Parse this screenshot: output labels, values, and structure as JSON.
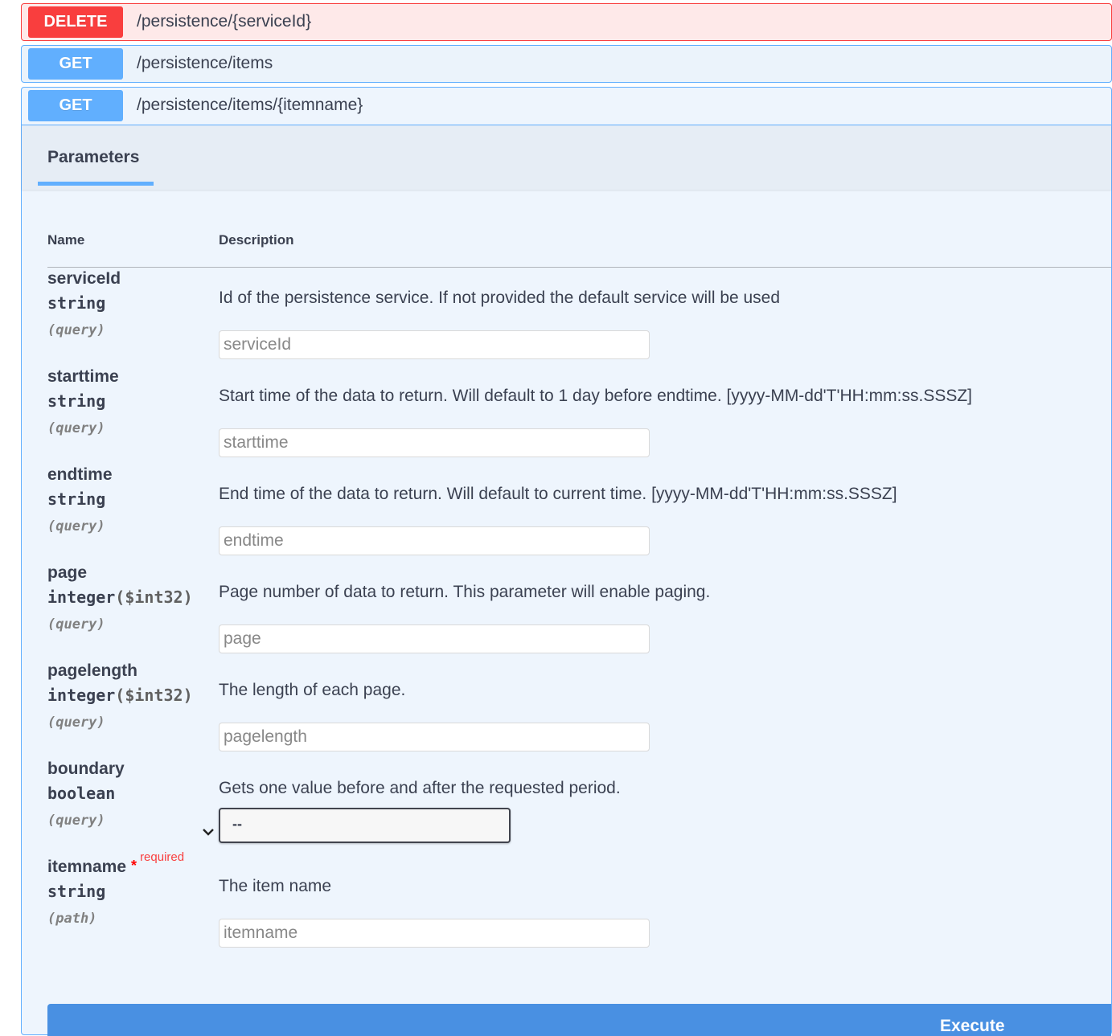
{
  "operations": [
    {
      "method": "DELETE",
      "path": "/persistence/{serviceId}"
    },
    {
      "method": "GET",
      "path": "/persistence/items"
    },
    {
      "method": "GET",
      "path": "/persistence/items/{itemname}"
    }
  ],
  "tab": "Parameters",
  "columns": {
    "name": "Name",
    "description": "Description"
  },
  "params": [
    {
      "name": "serviceId",
      "type": "string",
      "format": "",
      "in": "(query)",
      "description": "Id of the persistence service. If not provided the default service will be used",
      "placeholder": "serviceId",
      "control": "input"
    },
    {
      "name": "starttime",
      "type": "string",
      "format": "",
      "in": "(query)",
      "description": "Start time of the data to return. Will default to 1 day before endtime. [yyyy-MM-dd'T'HH:mm:ss.SSSZ]",
      "placeholder": "starttime",
      "control": "input"
    },
    {
      "name": "endtime",
      "type": "string",
      "format": "",
      "in": "(query)",
      "description": "End time of the data to return. Will default to current time. [yyyy-MM-dd'T'HH:mm:ss.SSSZ]",
      "placeholder": "endtime",
      "control": "input"
    },
    {
      "name": "page",
      "type": "integer",
      "format": "($int32)",
      "in": "(query)",
      "description": "Page number of data to return. This parameter will enable paging.",
      "placeholder": "page",
      "control": "input"
    },
    {
      "name": "pagelength",
      "type": "integer",
      "format": "($int32)",
      "in": "(query)",
      "description": "The length of each page.",
      "placeholder": "pagelength",
      "control": "input"
    },
    {
      "name": "boundary",
      "type": "boolean",
      "format": "",
      "in": "(query)",
      "description": "Gets one value before and after the requested period.",
      "selected": "--",
      "control": "select"
    },
    {
      "name": "itemname",
      "type": "string",
      "format": "",
      "in": "(path)",
      "description": "The item name",
      "placeholder": "itemname",
      "control": "input",
      "required_star": "*",
      "required": "required"
    }
  ],
  "execute": "Execute"
}
